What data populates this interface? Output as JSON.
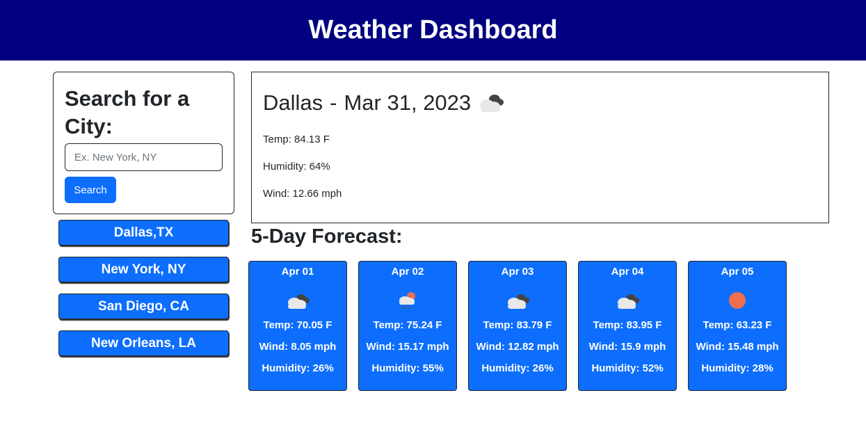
{
  "header": {
    "title": "Weather Dashboard",
    "bg": "#000080"
  },
  "search": {
    "heading": "Search for a City:",
    "placeholder": "Ex. New York, NY",
    "value": "",
    "button_label": "Search"
  },
  "history": [
    {
      "label": "Dallas,TX"
    },
    {
      "label": "New York, NY"
    },
    {
      "label": "San Diego, CA"
    },
    {
      "label": "New Orleans, LA"
    }
  ],
  "current": {
    "city": "Dallas",
    "separator": "-",
    "date": "Mar 31, 2023",
    "icon": "broken-clouds-icon",
    "temp": "Temp: 84.13 F",
    "humidity": "Humidity: 64%",
    "wind": "Wind: 12.66 mph"
  },
  "forecast": {
    "title": "5-Day Forecast:",
    "days": [
      {
        "date": "Apr 01",
        "icon": "broken-clouds-icon",
        "temp": "Temp: 70.05 F",
        "wind": "Wind: 8.05 mph",
        "humidity": "Humidity: 26%"
      },
      {
        "date": "Apr 02",
        "icon": "rain-sun-icon",
        "temp": "Temp: 75.24 F",
        "wind": "Wind: 15.17 mph",
        "humidity": "Humidity: 55%"
      },
      {
        "date": "Apr 03",
        "icon": "broken-clouds-icon",
        "temp": "Temp: 83.79 F",
        "wind": "Wind: 12.82 mph",
        "humidity": "Humidity: 26%"
      },
      {
        "date": "Apr 04",
        "icon": "broken-clouds-icon",
        "temp": "Temp: 83.95 F",
        "wind": "Wind: 15.9 mph",
        "humidity": "Humidity: 52%"
      },
      {
        "date": "Apr 05",
        "icon": "clear-sun-icon",
        "temp": "Temp: 63.23 F",
        "wind": "Wind: 15.48 mph",
        "humidity": "Humidity: 28%"
      }
    ]
  },
  "colors": {
    "accent": "#0d6efd",
    "sun": "#ee6e4f"
  }
}
